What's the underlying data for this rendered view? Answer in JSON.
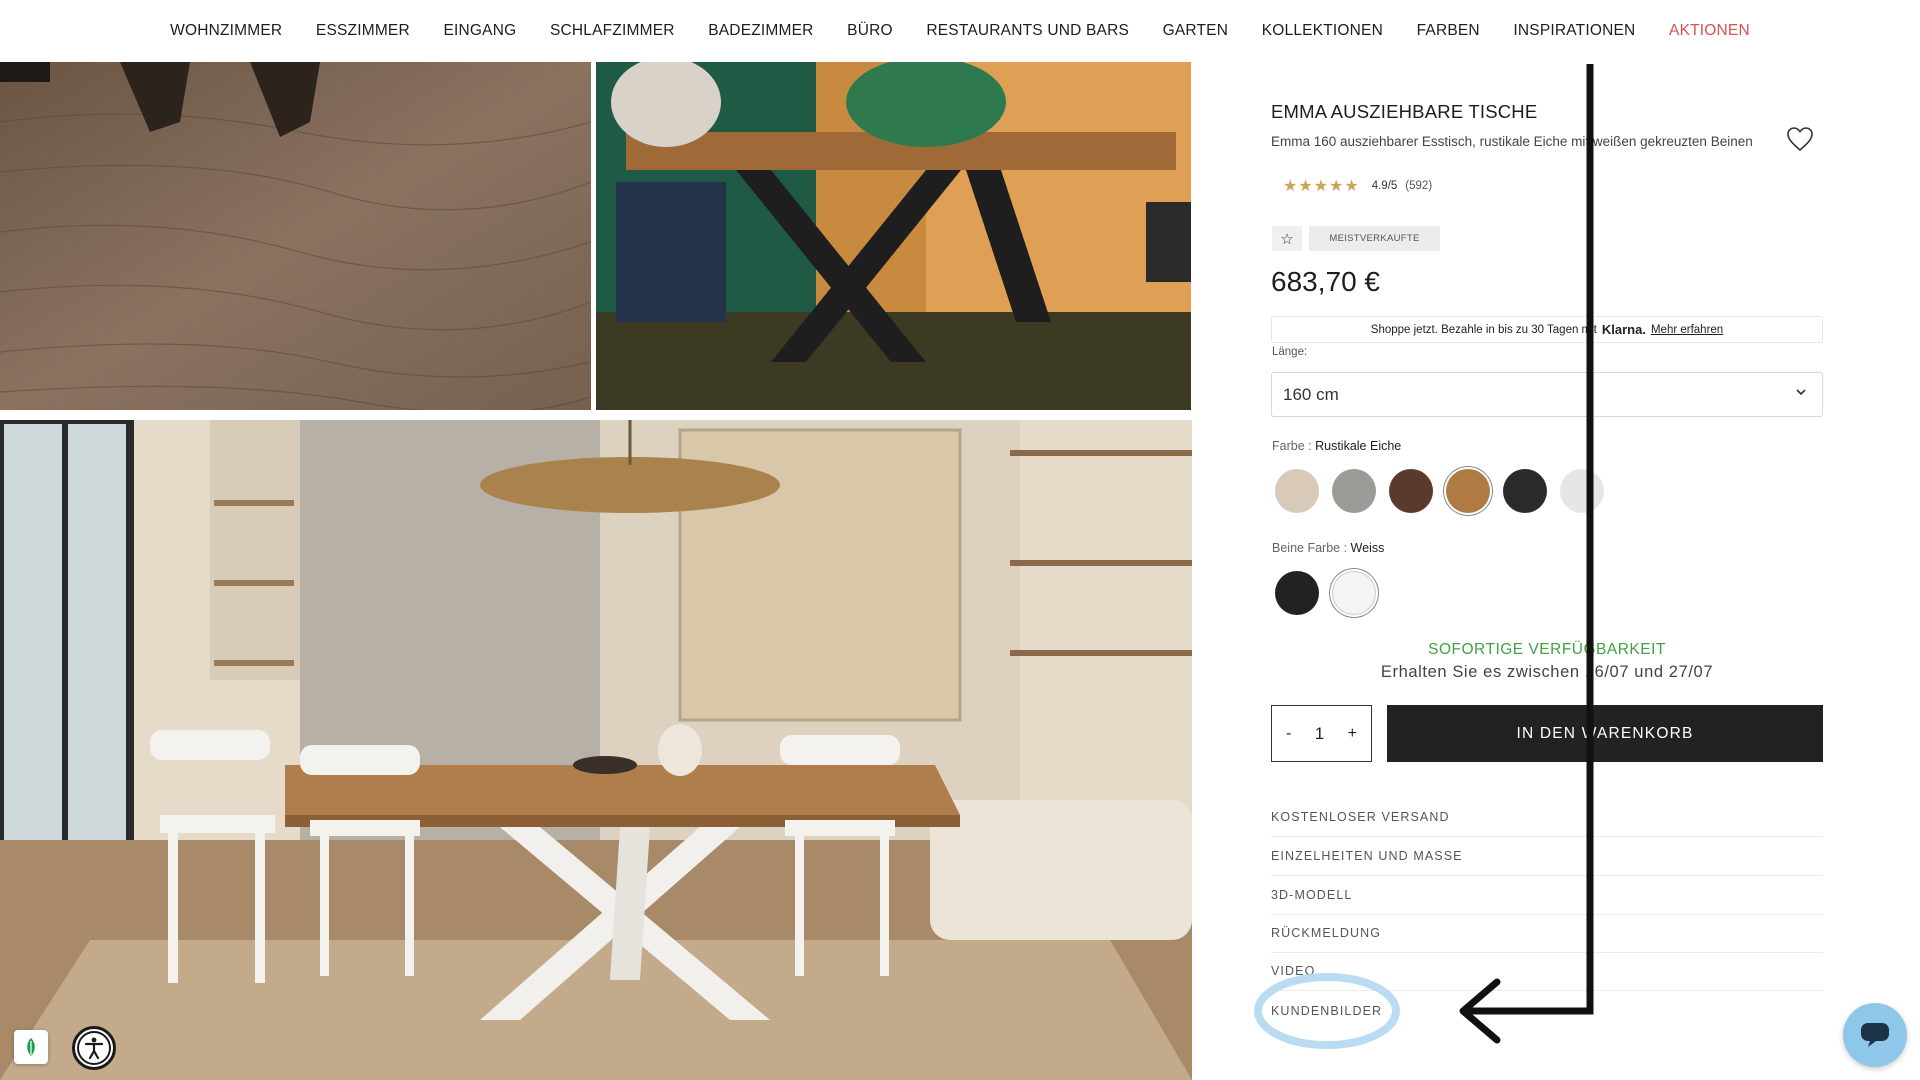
{
  "nav": {
    "items": [
      "WOHNZIMMER",
      "ESSZIMMER",
      "EINGANG",
      "SCHLAFZIMMER",
      "BADEZIMMER",
      "BÜRO",
      "RESTAURANTS UND BARS",
      "GARTEN",
      "KOLLEKTIONEN",
      "FARBEN",
      "INSPIRATIONEN",
      "AKTIONEN"
    ]
  },
  "product": {
    "title": "EMMA AUSZIEHBARE TISCHE",
    "subtitle": "Emma 160 ausziehbarer Esstisch, rustikale Eiche mit weißen gekreuzten Beinen",
    "rating_stars": "★★★★★",
    "rating_score": "4.9/5",
    "rating_count": "(592)",
    "badge": "MEISTVERKAUFTE",
    "price": "683,70 €"
  },
  "klarna": {
    "text": "Shoppe jetzt. Bezahle in bis zu 30 Tagen mit",
    "brand": "Klarna.",
    "link": "Mehr erfahren"
  },
  "length": {
    "label": "Länge:",
    "value": "160 cm"
  },
  "color": {
    "label": "Farbe :",
    "value": "Rustikale Eiche",
    "swatches": [
      "#d8c9b8",
      "#9a9a96",
      "#5a3a2a",
      "#b07a45",
      "#2a2a2c",
      "#e6e6e6"
    ]
  },
  "leg_color": {
    "label": "Beine Farbe :",
    "value": "Weiss",
    "swatches": [
      "#222222",
      "#f4f4f4"
    ]
  },
  "availability": {
    "status": "SOFORTIGE VERFÜGBARKEIT",
    "delivery": "Erhalten Sie es zwischen 16/07 und 27/07"
  },
  "cart": {
    "minus": "-",
    "qty": "1",
    "plus": "+",
    "button": "IN DEN WARENKORB"
  },
  "accordion": [
    "KOSTENLOSER VERSAND",
    "EINZELHEITEN UND MASSE",
    "3D-MODELL",
    "RÜCKMELDUNG",
    "VIDEO",
    "KUNDENBILDER"
  ],
  "colors": {
    "accent_red": "#d9534f",
    "stock_green": "#43a047",
    "highlight_blue": "#b9dcf2",
    "button_dark": "#222222"
  }
}
